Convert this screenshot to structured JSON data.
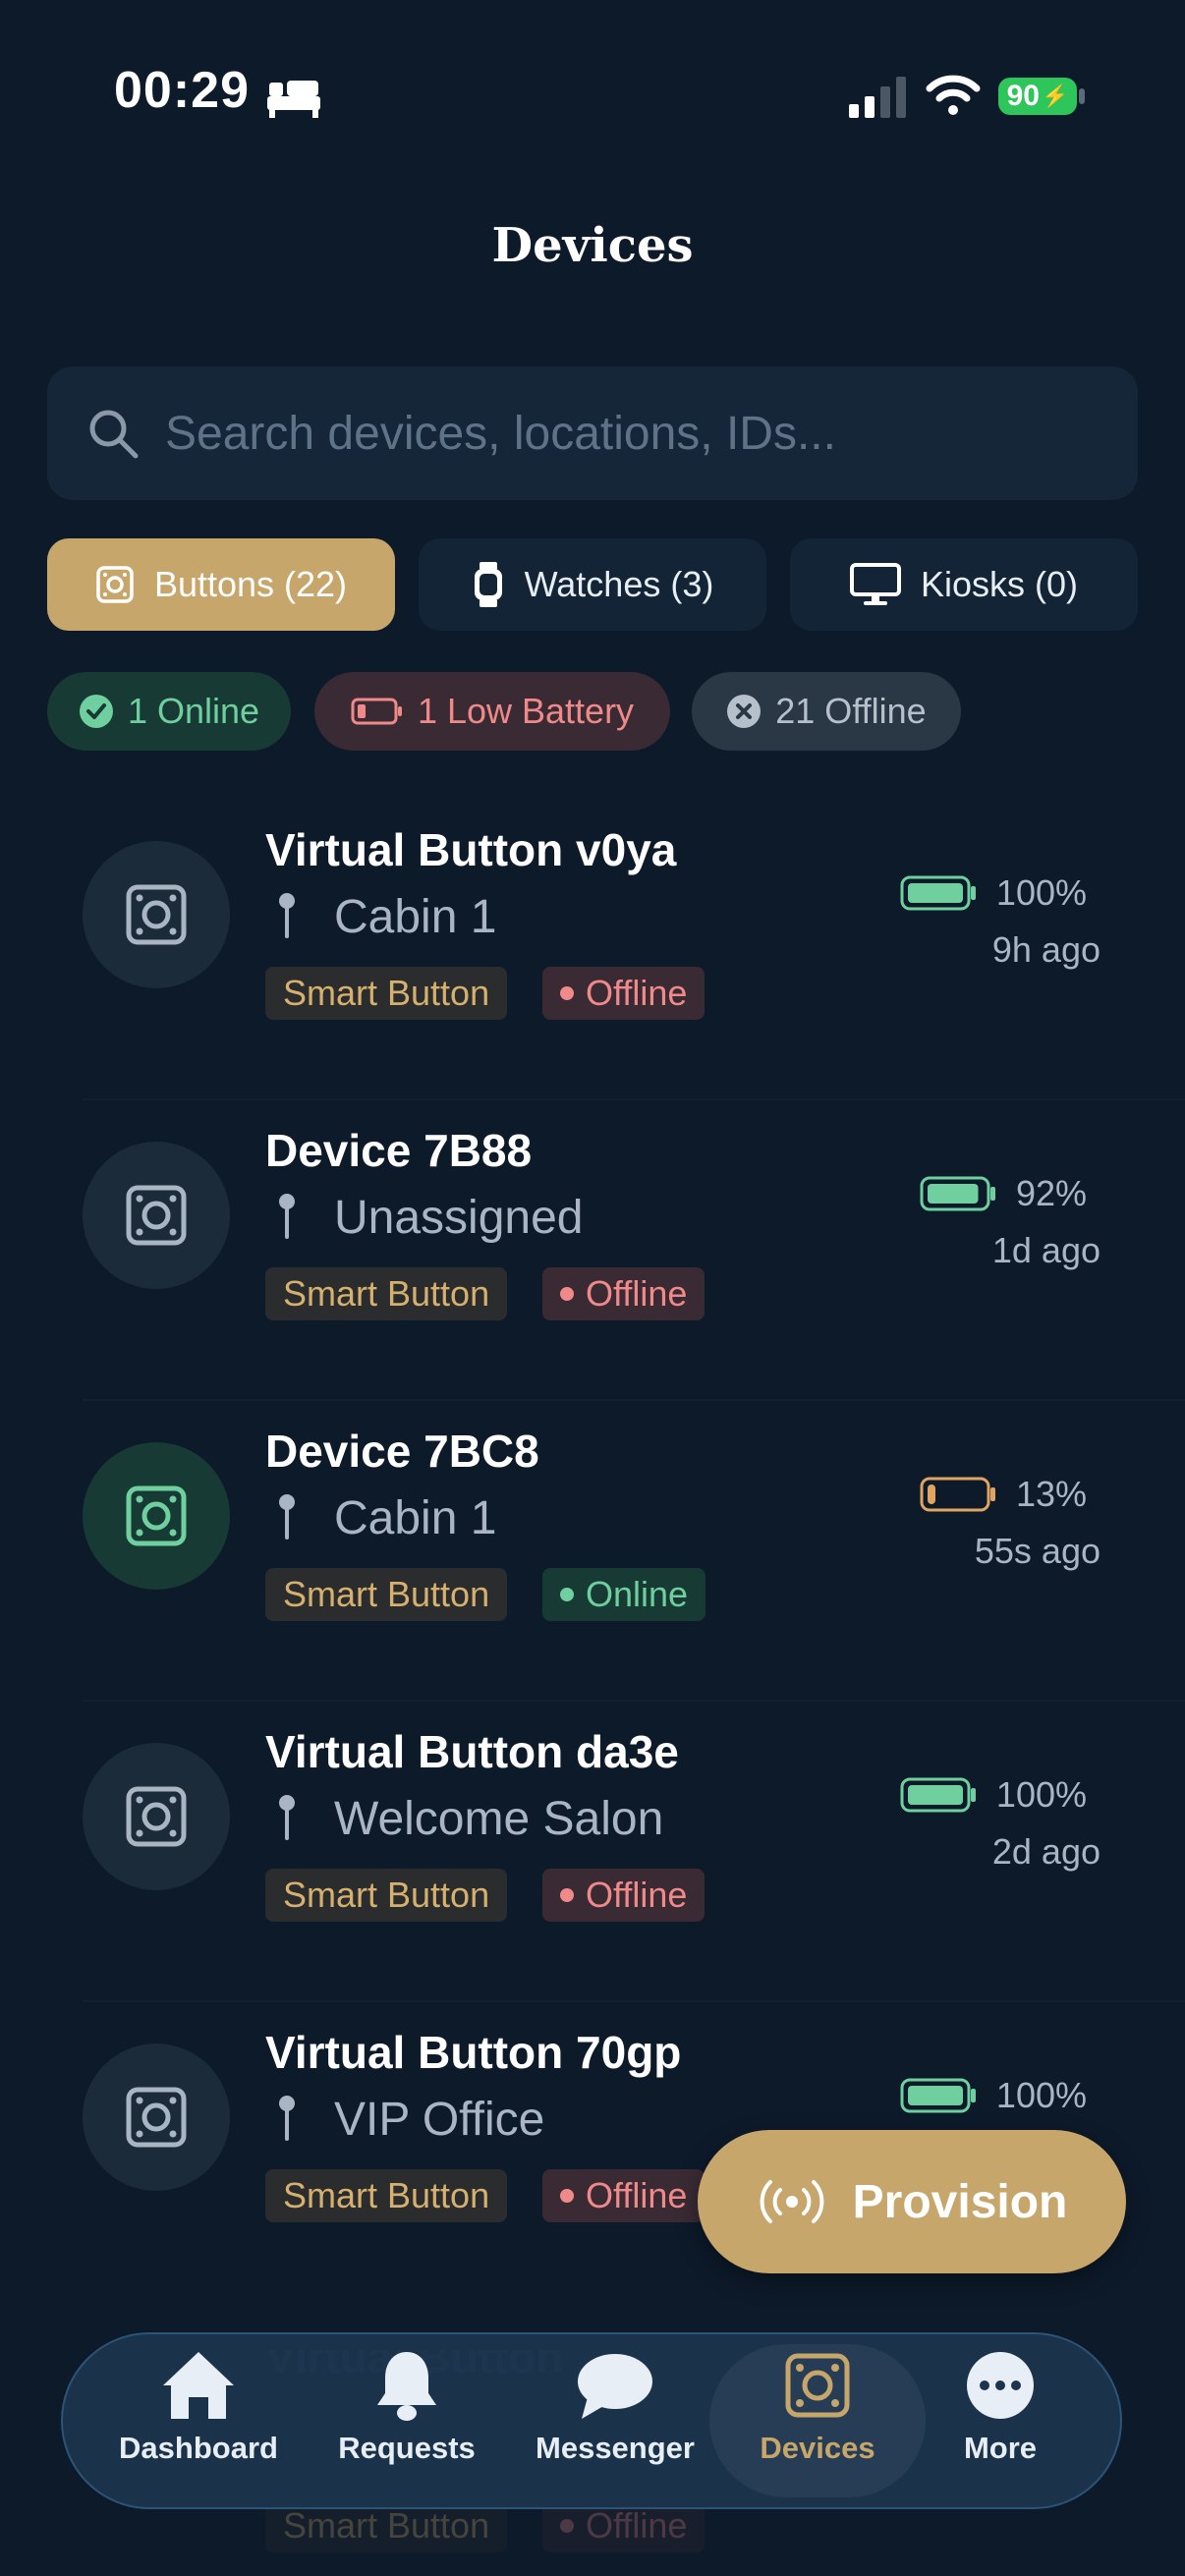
{
  "status_bar": {
    "time": "00:29",
    "battery_level": "90"
  },
  "header": {
    "title": "Devices"
  },
  "search": {
    "placeholder": "Search devices, locations, IDs..."
  },
  "tabs": [
    {
      "label": "Buttons (22)",
      "icon": "smart-button-icon",
      "active": true
    },
    {
      "label": "Watches (3)",
      "icon": "watch-icon",
      "active": false
    },
    {
      "label": "Kiosks (0)",
      "icon": "monitor-icon",
      "active": false
    }
  ],
  "filters": [
    {
      "label": "1 Online",
      "icon": "check-circle-icon",
      "color": "#6fcf9e"
    },
    {
      "label": "1 Low Battery",
      "icon": "low-battery-icon",
      "color": "#f08a8a"
    },
    {
      "label": "21 Offline",
      "icon": "x-circle-icon",
      "color": "#b6c0cb"
    }
  ],
  "devices": [
    {
      "name": "Virtual Button v0ya",
      "location": "Cabin 1",
      "type": "Smart Button",
      "status": "Offline",
      "battery": "100%",
      "battery_level": 1.0,
      "last_seen": "9h ago"
    },
    {
      "name": "Device 7B88",
      "location": "Unassigned",
      "type": "Smart Button",
      "status": "Offline",
      "battery": "92%",
      "battery_level": 0.92,
      "last_seen": "1d ago"
    },
    {
      "name": "Device 7BC8",
      "location": "Cabin 1",
      "type": "Smart Button",
      "status": "Online",
      "battery": "13%",
      "battery_level": 0.13,
      "last_seen": "55s ago"
    },
    {
      "name": "Virtual Button da3e",
      "location": "Welcome Salon",
      "type": "Smart Button",
      "status": "Offline",
      "battery": "100%",
      "battery_level": 1.0,
      "last_seen": "2d ago"
    },
    {
      "name": "Virtual Button 70gp",
      "location": "VIP Office",
      "type": "Smart Button",
      "status": "Offline",
      "battery": "100%",
      "battery_level": 1.0,
      "last_seen": ""
    }
  ],
  "fab": {
    "label": "Provision",
    "icon": "broadcast-icon"
  },
  "nav": [
    {
      "label": "Dashboard",
      "icon": "home-icon",
      "active": false
    },
    {
      "label": "Requests",
      "icon": "bell-icon",
      "active": false
    },
    {
      "label": "Messenger",
      "icon": "chat-icon",
      "active": false
    },
    {
      "label": "Devices",
      "icon": "smart-button-icon",
      "active": true
    },
    {
      "label": "More",
      "icon": "more-icon",
      "active": false
    }
  ],
  "colors": {
    "background": "#0d1a2a",
    "accent": "#c7a66c",
    "online": "#6fcf9e",
    "offline": "#f08a8a",
    "low_battery": "#e0a560"
  }
}
